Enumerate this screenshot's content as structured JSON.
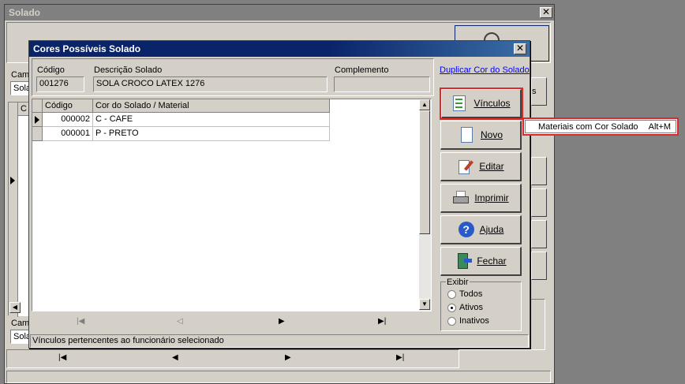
{
  "bg_window": {
    "title": "Solado",
    "close_label": "✕",
    "field_label_1": "Cam",
    "field_value_1": "Sola",
    "grid_header": "C",
    "field_label_2": "Cam",
    "field_value_2": "Sola",
    "btn_partial": "s",
    "nav": {
      "first": "|◀",
      "prev": "◀",
      "next": "▶",
      "last": "▶|"
    }
  },
  "dialog": {
    "title": "Cores Possíveis Solado",
    "close_label": "✕",
    "codigo_label": "Código",
    "codigo_value": "001276",
    "descricao_label": "Descrição Solado",
    "descricao_value": "SOLA CROCO LATEX 1276",
    "complemento_label": "Complemento",
    "complemento_value": "",
    "duplicar_link": "Duplicar Cor do Solado",
    "grid": {
      "headers": [
        "Código",
        "Cor do Solado / Material"
      ],
      "rows": [
        {
          "codigo": "000002",
          "cor": "C - CAFE"
        },
        {
          "codigo": "000001",
          "cor": "P - PRETO"
        }
      ]
    },
    "nav": {
      "first": "|◀",
      "prev": "◁",
      "next": "▶",
      "last": "▶|"
    },
    "buttons": {
      "vinculos": "Vínculos",
      "novo": "Novo",
      "editar": "Editar",
      "imprimir": "Imprimir",
      "ajuda": "Ajuda",
      "fechar": "Fechar"
    },
    "exibir": {
      "legend": "Exibir",
      "todos": "Todos",
      "ativos": "Ativos",
      "inativos": "Inativos",
      "selected": "Ativos"
    },
    "status_text": "Vínculos pertencentes ao funcionário selecionado"
  },
  "popup_menu": {
    "item_label": "Materiais com Cor Solado",
    "item_shortcut": "Alt+M"
  },
  "colors": {
    "highlight": "#e0282a",
    "titlebar": "#0a246a",
    "link": "#0000ff"
  }
}
